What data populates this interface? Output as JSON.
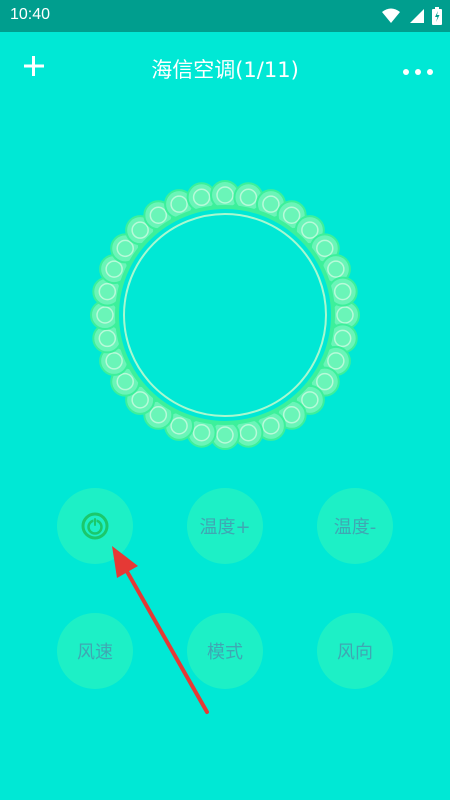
{
  "status": {
    "time": "10:40"
  },
  "header": {
    "title": "海信空调(1/11)"
  },
  "controls": {
    "power": "power-icon",
    "temp_up": "温度+",
    "temp_down": "温度-",
    "fan_speed": "风速",
    "mode": "模式",
    "direction": "风向"
  },
  "colors": {
    "background": "#00E8D5",
    "statusbar": "#009E8E",
    "button": "#1DF0C6",
    "button_text": "#3FA7B3",
    "power_icon": "#1BC86B",
    "ring": "#3DF09B",
    "arrow": "#E53935"
  }
}
